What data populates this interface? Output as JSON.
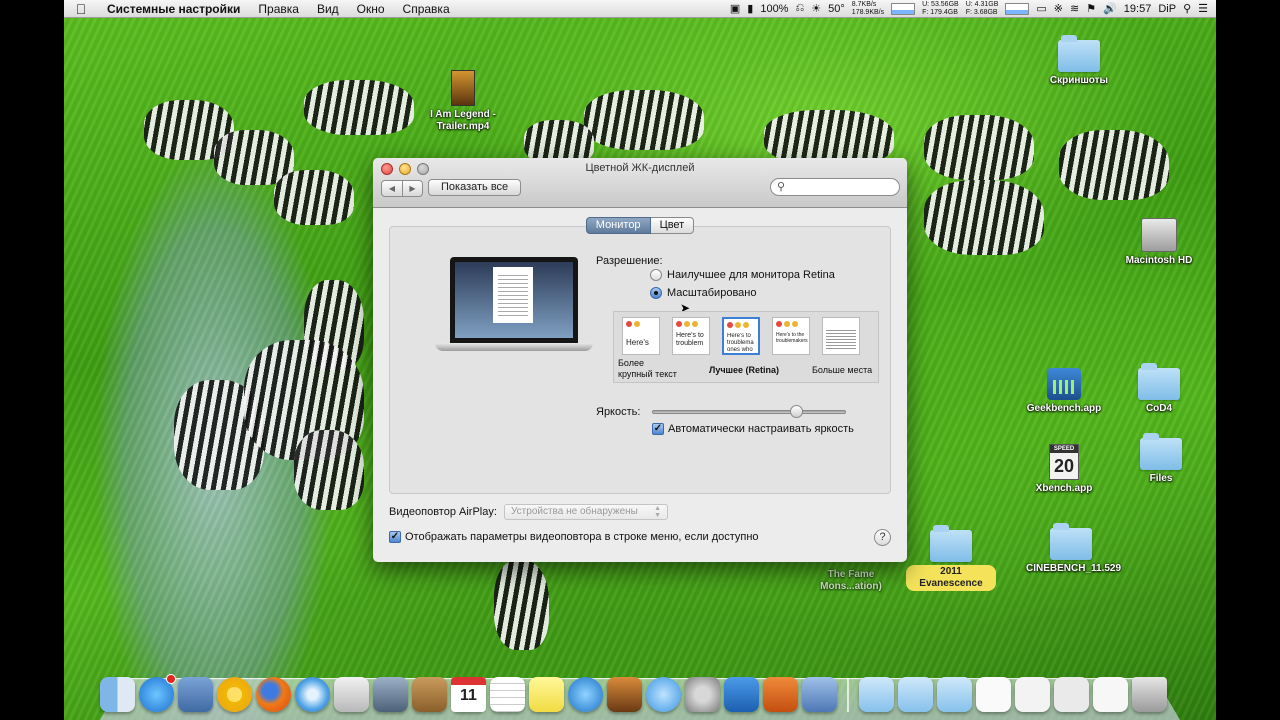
{
  "menubar": {
    "app_name": "Системные настройки",
    "menus": [
      "Правка",
      "Вид",
      "Окно",
      "Справка"
    ],
    "battery_percent": "100%",
    "temperature": "50°",
    "net_up": "8.7KB/s",
    "net_down": "178.9KB/s",
    "disk_u1": "U: 53.56GB",
    "disk_f1": "F: 179.4GB",
    "disk_u2": "U: 4.31GB",
    "disk_f2": "F: 3.68GB",
    "time": "19:57",
    "user": "DiP"
  },
  "desktop": {
    "icons": [
      {
        "label": "Скриншоты"
      },
      {
        "label": "I Am Legend - Trailer.mp4"
      },
      {
        "label": "Macintosh HD"
      },
      {
        "label": "Geekbench.app"
      },
      {
        "label": "CoD4"
      },
      {
        "label": "Xbench.app",
        "speed_top": "SPEED",
        "speed_num": "20"
      },
      {
        "label": "Files"
      },
      {
        "label": "The Fame Mons...ation)"
      },
      {
        "label": "2011 Evanescence"
      },
      {
        "label": "CINEBENCH_11.529"
      }
    ]
  },
  "window": {
    "title": "Цветной ЖК-дисплей",
    "show_all": "Показать все",
    "search_placeholder": "",
    "tabs": [
      "Монитор",
      "Цвет"
    ],
    "resolution_label": "Разрешение:",
    "radio_best": "Наилучшее для монитора Retina",
    "radio_scaled": "Масштабировано",
    "selected_option": "Масштабировано",
    "scale_previews": [
      {
        "text": "Here's"
      },
      {
        "text": "Here's to troublem"
      },
      {
        "text": "Here's to troublema ones who"
      },
      {
        "text": "Here's to the troublemakers"
      },
      {
        "text": ""
      }
    ],
    "scale_labels": {
      "left_1": "Более",
      "left_2": "крупный текст",
      "middle": "Лучшее (Retina)",
      "right": "Больше места"
    },
    "selected_scale_index": 2,
    "brightness_label": "Яркость:",
    "brightness_value": 0.74,
    "auto_brightness_label": "Автоматически настраивать яркость",
    "auto_brightness_checked": true,
    "airplay_label": "Видеоповтор AirPlay:",
    "airplay_value": "Устройства не обнаружены",
    "show_mirroring_label": "Отображать параметры видеоповтора в строке меню, если доступно",
    "show_mirroring_checked": true,
    "help": "?"
  },
  "dock": {
    "calendar_day": "11",
    "apps": [
      "finder-icon",
      "app-store-icon",
      "preview-icon",
      "chrome-icon",
      "firefox-icon",
      "safari-icon",
      "textwrangler-icon",
      "facetime-icon",
      "address-book-icon",
      "calendar-icon",
      "reminders-icon",
      "stickies-icon",
      "itunes-icon",
      "photo-booth-icon",
      "messages-icon",
      "system-preferences-icon",
      "word-icon",
      "powerpoint-icon",
      "screenflow-icon"
    ]
  }
}
